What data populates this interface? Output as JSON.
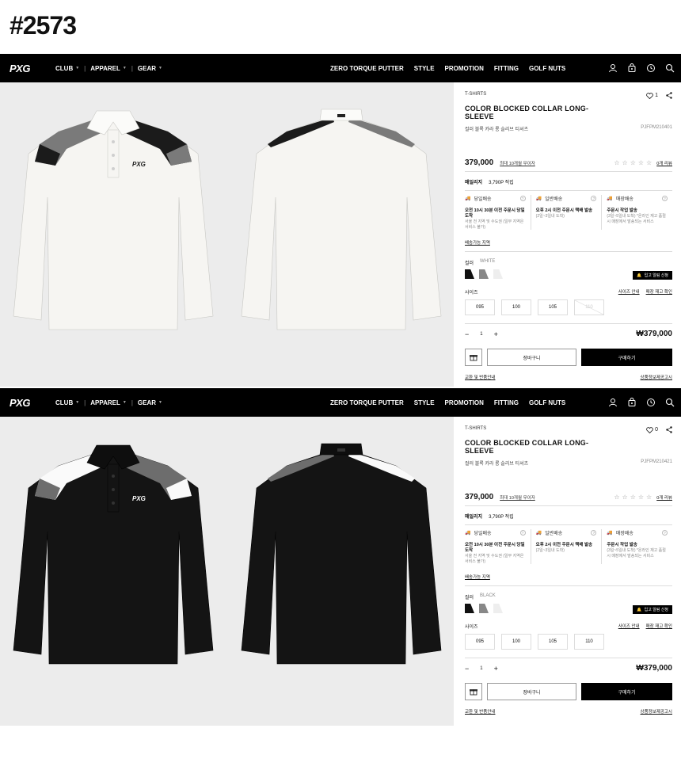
{
  "page_id": "#2573",
  "nav": {
    "logo": "PXG",
    "left_items": [
      {
        "label": "CLUB"
      },
      {
        "label": "APPAREL"
      },
      {
        "label": "GEAR"
      }
    ],
    "right_items": [
      "ZERO TORQUE PUTTER",
      "STYLE",
      "PROMOTION",
      "FITTING",
      "GOLF NUTS"
    ],
    "icons": [
      "user-icon",
      "bag-icon",
      "history-icon",
      "search-icon"
    ]
  },
  "products": [
    {
      "variant": "white",
      "category": "T-SHIRTS",
      "wish_count": "1",
      "title": "COLOR BLOCKED COLLAR LONG-SLEEVE",
      "subtitle": "컬러 블록 카라 롱 슬리브 티셔츠",
      "sku": "PJFPM210401",
      "price": "379,000",
      "installment": "최대 10개월 무이자",
      "review_count": "0개 리뷰",
      "points_label": "매일리지",
      "points_value": "3,790P 적립",
      "delivery": [
        {
          "title": "당일배송",
          "bold": "오전 10시 30분 이전 주문시 당일도착",
          "small": "서울 전 지역 및 수도권 (일부 지역은 서비스 불가)"
        },
        {
          "title": "일반배송",
          "bold": "오후 2시 이전 주문시 택배 발송",
          "small": "(2일~3일내 도착)"
        },
        {
          "title": "매장배송",
          "bold": "주문시 작업 발송",
          "small": "(3일~5일내 도착) *온라인 재고 품절시 매장에서 발송되는 서비스"
        }
      ],
      "delivery_link": "배송가능 지역",
      "color_label": "컬러",
      "color_value": "WHITE",
      "swatches": [
        "#111111",
        "#888888",
        "#eeeeee"
      ],
      "restock": "입고 알림 신청",
      "size_label": "사이즈",
      "size_links": [
        "사이즈 안내",
        "매장 재고 확인"
      ],
      "sizes": [
        {
          "label": "095",
          "disabled": false
        },
        {
          "label": "100",
          "disabled": false
        },
        {
          "label": "105",
          "disabled": false
        },
        {
          "label": "110",
          "disabled": true
        }
      ],
      "qty_minus": "−",
      "qty": "1",
      "qty_plus": "+",
      "total": "₩379,000",
      "cart_label": "장바구니",
      "buy_label": "구매하기",
      "foot_left": "교환 및 반품안내",
      "foot_right": "상품정보제공고시"
    },
    {
      "variant": "black",
      "category": "T-SHIRTS",
      "wish_count": "0",
      "title": "COLOR BLOCKED COLLAR LONG-SLEEVE",
      "subtitle": "컬러 블록 카라 롱 슬리브 티셔츠",
      "sku": "PJFPM210421",
      "price": "379,000",
      "installment": "최대 10개월 무이자",
      "review_count": "0개 리뷰",
      "points_label": "매일리지",
      "points_value": "3,790P 적립",
      "delivery": [
        {
          "title": "당일배송",
          "bold": "오전 10시 30분 이전 주문시 당일도착",
          "small": "서울 전 지역 및 수도권 (일부 지역은 서비스 불가)"
        },
        {
          "title": "일반배송",
          "bold": "오후 2시 이전 주문시 택배 발송",
          "small": "(2일~3일내 도착)"
        },
        {
          "title": "매장배송",
          "bold": "주문시 작업 발송",
          "small": "(3일~5일내 도착) *온라인 재고 품절시 매장에서 발송되는 서비스"
        }
      ],
      "delivery_link": "배송가능 지역",
      "color_label": "컬러",
      "color_value": "BLACK",
      "swatches": [
        "#111111",
        "#888888",
        "#eeeeee"
      ],
      "restock": "입고 알림 신청",
      "size_label": "사이즈",
      "size_links": [
        "사이즈 안내",
        "매장 재고 확인"
      ],
      "sizes": [
        {
          "label": "095",
          "disabled": false
        },
        {
          "label": "100",
          "disabled": false
        },
        {
          "label": "105",
          "disabled": false
        },
        {
          "label": "110",
          "disabled": false
        }
      ],
      "qty_minus": "−",
      "qty": "1",
      "qty_plus": "+",
      "total": "₩379,000",
      "cart_label": "장바구니",
      "buy_label": "구매하기",
      "foot_left": "교환 및 반품안내",
      "foot_right": "상품정보제공고시"
    }
  ]
}
